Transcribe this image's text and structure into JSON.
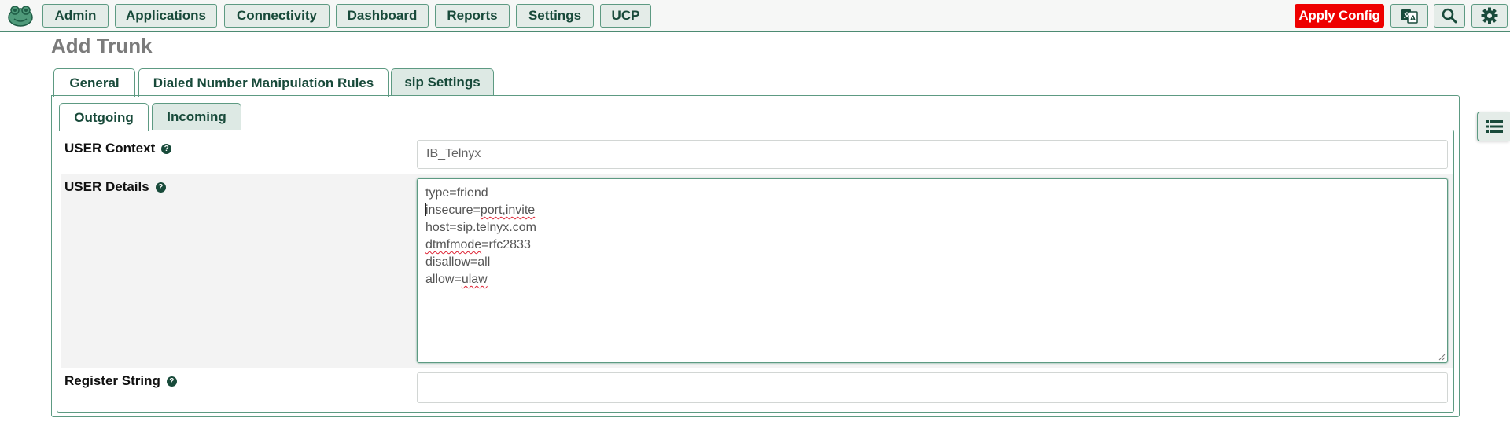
{
  "nav": {
    "items": [
      "Admin",
      "Applications",
      "Connectivity",
      "Dashboard",
      "Reports",
      "Settings",
      "UCP"
    ],
    "apply_config": "Apply Config"
  },
  "page": {
    "title": "Add Trunk"
  },
  "tabs": [
    "General",
    "Dialed Number Manipulation Rules",
    "sip Settings"
  ],
  "active_tab": "sip Settings",
  "subtabs": [
    "Outgoing",
    "Incoming"
  ],
  "active_subtab": "Incoming",
  "form": {
    "user_context": {
      "label": "USER Context",
      "value": "IB_Telnyx"
    },
    "user_details": {
      "label": "USER Details",
      "lines": [
        "type=friend",
        "insecure=port,invite",
        "host=sip.telnyx.com",
        "dtmfmode=rfc2833",
        "disallow=all",
        "allow=ulaw"
      ]
    },
    "register_string": {
      "label": "Register String",
      "value": ""
    }
  },
  "colors": {
    "accent": "#184a3a",
    "border": "#5d9a82",
    "apply": "#ee0000"
  }
}
